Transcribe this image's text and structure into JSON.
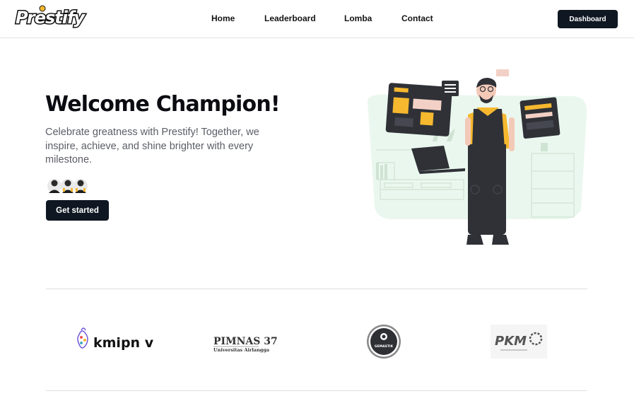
{
  "brand": {
    "logo_text": "Prestify"
  },
  "nav": {
    "links": [
      "Home",
      "Leaderboard",
      "Lomba",
      "Contact"
    ],
    "dashboard_label": "Dashboard"
  },
  "hero": {
    "title": "Welcome Champion!",
    "description": "Celebrate greatness with Prestify! Together, we inspire, achieve, and shine brighter with every milestone.",
    "cta_label": "Get started"
  },
  "partners": {
    "logos": [
      {
        "name": "kmipn-logo",
        "text": "kmipn v"
      },
      {
        "name": "pimnas-logo",
        "text": "PIMNAS 37",
        "subtext": "Universitas Airlangga"
      },
      {
        "name": "gemastik-logo",
        "text": "GEMASTIK"
      },
      {
        "name": "pkm-logo",
        "text": "PKM"
      }
    ]
  },
  "colors": {
    "primary_dark": "#0f1722",
    "accent_yellow": "#f5b82e",
    "illustration_bg": "#eaf7ee"
  }
}
